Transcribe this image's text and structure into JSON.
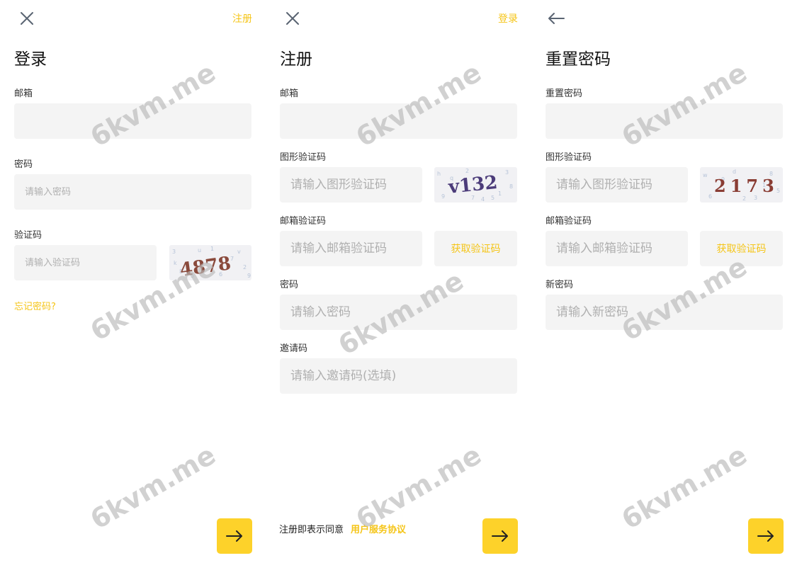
{
  "watermark": "6kvm.me",
  "accent": "#fdd22a",
  "login": {
    "close_icon": "close-icon",
    "switch_link": "注册",
    "title": "登录",
    "email_label": "邮箱",
    "email_value": "",
    "password_label": "密码",
    "password_placeholder": "请输入密码",
    "captcha_label": "验证码",
    "captcha_placeholder": "请输入验证码",
    "captcha_text": "4878",
    "forgot_link": "忘记密码?",
    "submit_icon": "arrow-right-icon"
  },
  "register": {
    "close_icon": "close-icon",
    "switch_link": "登录",
    "title": "注册",
    "email_label": "邮箱",
    "image_code_label": "图形验证码",
    "image_code_placeholder": "请输入图形验证码",
    "captcha_text": "v132",
    "email_code_label": "邮箱验证码",
    "email_code_placeholder": "请输入邮箱验证码",
    "get_code_button": "获取验证码",
    "password_label": "密码",
    "password_placeholder": "请输入密码",
    "invite_label": "邀请码",
    "invite_placeholder": "请输入邀请码(选填)",
    "agree_text": "注册即表示同意",
    "agreement_link": "用户服务协议",
    "submit_icon": "arrow-right-icon"
  },
  "reset": {
    "back_icon": "arrow-left-icon",
    "title": "重置密码",
    "field_label": "重置密码",
    "image_code_label": "图形验证码",
    "image_code_placeholder": "请输入图形验证码",
    "captcha_text": "2173",
    "email_code_label": "邮箱验证码",
    "email_code_placeholder": "请输入邮箱验证码",
    "get_code_button": "获取验证码",
    "new_password_label": "新密码",
    "new_password_placeholder": "请输入新密码",
    "submit_icon": "arrow-right-icon"
  }
}
